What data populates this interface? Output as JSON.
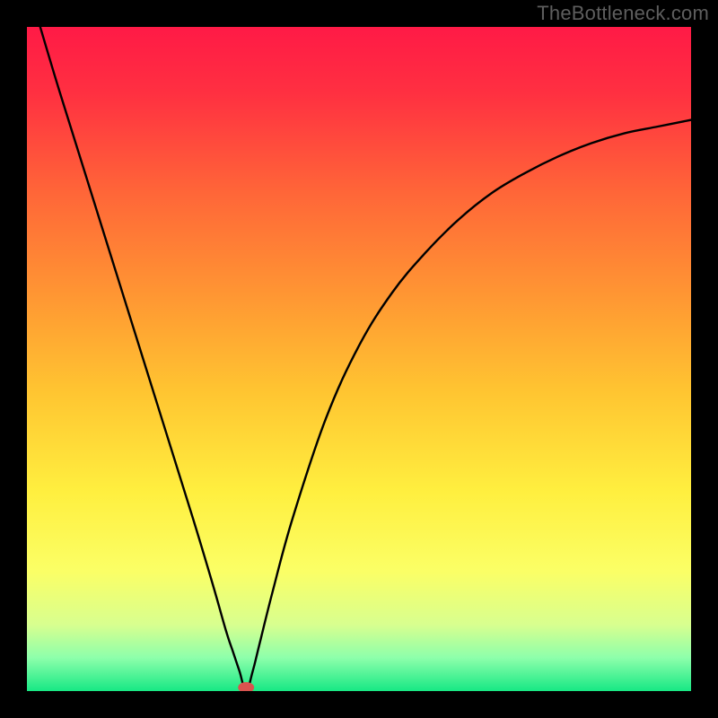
{
  "watermark": "TheBottleneck.com",
  "chart_data": {
    "type": "line",
    "title": "",
    "xlabel": "",
    "ylabel": "",
    "xlim": [
      0,
      100
    ],
    "ylim": [
      0,
      100
    ],
    "grid": false,
    "legend": false,
    "marker": {
      "x": 33,
      "y": 0,
      "color": "#d9534f"
    },
    "series": [
      {
        "name": "curve",
        "x": [
          2,
          5,
          10,
          15,
          20,
          25,
          28,
          30,
          31,
          32,
          33,
          34,
          35,
          37,
          40,
          45,
          50,
          55,
          60,
          65,
          70,
          75,
          80,
          85,
          90,
          95,
          100
        ],
        "y": [
          100,
          90,
          74,
          58,
          42,
          26,
          16,
          9,
          6,
          3,
          0,
          3,
          7,
          15,
          26,
          41,
          52,
          60,
          66,
          71,
          75,
          78,
          80.5,
          82.5,
          84,
          85,
          86
        ]
      }
    ],
    "background_gradient": [
      {
        "stop": 0.0,
        "color": "#ff1a46"
      },
      {
        "stop": 0.1,
        "color": "#ff3041"
      },
      {
        "stop": 0.25,
        "color": "#ff6638"
      },
      {
        "stop": 0.4,
        "color": "#ff9533"
      },
      {
        "stop": 0.55,
        "color": "#ffc531"
      },
      {
        "stop": 0.7,
        "color": "#ffef3f"
      },
      {
        "stop": 0.82,
        "color": "#fbff66"
      },
      {
        "stop": 0.9,
        "color": "#d8ff8f"
      },
      {
        "stop": 0.95,
        "color": "#8dffab"
      },
      {
        "stop": 1.0,
        "color": "#17e884"
      }
    ]
  }
}
